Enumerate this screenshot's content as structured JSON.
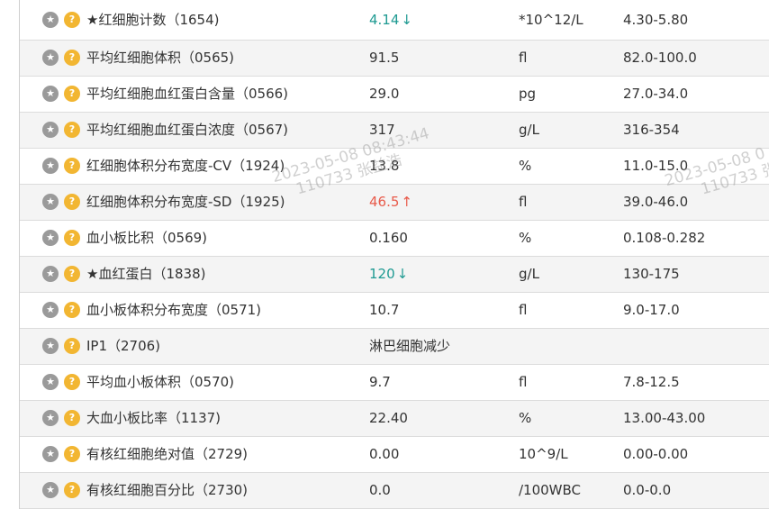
{
  "icons": {
    "star_icon": "star-icon",
    "help_icon": "help-icon",
    "star_glyph": "★",
    "help_glyph": "?"
  },
  "rows": [
    {
      "name": "★红细胞计数（1654)",
      "result": "4.14",
      "flag": "↓",
      "flag_type": "low",
      "unit": "*10^12/L",
      "range": "4.30-5.80"
    },
    {
      "name": "平均红细胞体积（0565)",
      "result": "91.5",
      "flag": "",
      "flag_type": "",
      "unit": "fl",
      "range": "82.0-100.0"
    },
    {
      "name": "平均红细胞血红蛋白含量（0566)",
      "result": "29.0",
      "flag": "",
      "flag_type": "",
      "unit": "pg",
      "range": "27.0-34.0"
    },
    {
      "name": "平均红细胞血红蛋白浓度（0567)",
      "result": "317",
      "flag": "",
      "flag_type": "",
      "unit": "g/L",
      "range": "316-354"
    },
    {
      "name": "红细胞体积分布宽度-CV（1924)",
      "result": "13.8",
      "flag": "",
      "flag_type": "",
      "unit": "%",
      "range": "11.0-15.0"
    },
    {
      "name": "红细胞体积分布宽度-SD（1925)",
      "result": "46.5",
      "flag": "↑",
      "flag_type": "high",
      "unit": "fl",
      "range": "39.0-46.0"
    },
    {
      "name": "血小板比积（0569)",
      "result": "0.160",
      "flag": "",
      "flag_type": "",
      "unit": "%",
      "range": "0.108-0.282"
    },
    {
      "name": "★血红蛋白（1838)",
      "result": "120",
      "flag": "↓",
      "flag_type": "low",
      "unit": "g/L",
      "range": "130-175"
    },
    {
      "name": "血小板体积分布宽度（0571)",
      "result": "10.7",
      "flag": "",
      "flag_type": "",
      "unit": "fl",
      "range": "9.0-17.0"
    },
    {
      "name": "IP1（2706)",
      "result": "淋巴细胞减少",
      "flag": "",
      "flag_type": "",
      "unit": "",
      "range": ""
    },
    {
      "name": "平均血小板体积（0570)",
      "result": "9.7",
      "flag": "",
      "flag_type": "",
      "unit": "fl",
      "range": "7.8-12.5"
    },
    {
      "name": "大血小板比率（1137)",
      "result": "22.40",
      "flag": "",
      "flag_type": "",
      "unit": "%",
      "range": "13.00-43.00"
    },
    {
      "name": "有核红细胞绝对值（2729)",
      "result": "0.00",
      "flag": "",
      "flag_type": "",
      "unit": "10^9/L",
      "range": "0.00-0.00"
    },
    {
      "name": "有核红细胞百分比（2730)",
      "result": "0.0",
      "flag": "",
      "flag_type": "",
      "unit": "/100WBC",
      "range": "0.0-0.0"
    }
  ],
  "watermarks": [
    {
      "line1": "2023-05-08 08:43:44",
      "line2": "110733 张益浩"
    },
    {
      "line1": "2023-05-08 0",
      "line2": "110733 张"
    }
  ]
}
